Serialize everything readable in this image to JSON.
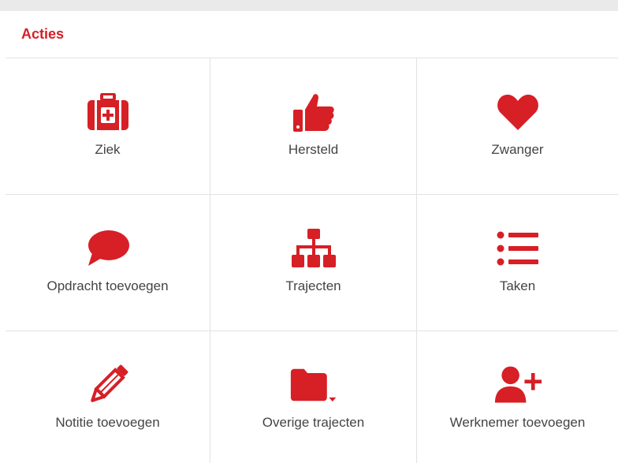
{
  "panel": {
    "title": "Acties"
  },
  "accent_color": "#d71f26",
  "actions": [
    {
      "label": "Ziek",
      "icon": "medkit-icon"
    },
    {
      "label": "Hersteld",
      "icon": "thumbs-up-icon"
    },
    {
      "label": "Zwanger",
      "icon": "heart-icon"
    },
    {
      "label": "Opdracht toevoegen",
      "icon": "comment-icon"
    },
    {
      "label": "Trajecten",
      "icon": "sitemap-icon"
    },
    {
      "label": "Taken",
      "icon": "list-icon"
    },
    {
      "label": "Notitie toevoegen",
      "icon": "pencil-icon"
    },
    {
      "label": "Overige trajecten",
      "icon": "folder-dropdown-icon"
    },
    {
      "label": "Werknemer toevoegen",
      "icon": "user-plus-icon"
    }
  ]
}
